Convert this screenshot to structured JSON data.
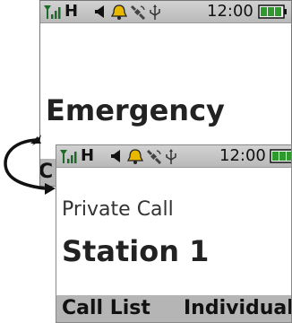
{
  "status_bar": {
    "network_letter": "H",
    "time": "12:00",
    "icons": [
      "signal-strength-icon",
      "speaker-icon",
      "bell-icon",
      "satellite-icon",
      "usb-icon",
      "battery-icon"
    ]
  },
  "back_screen": {
    "title": "Emergency",
    "softkey_left": "C"
  },
  "front_screen": {
    "call_type": "Private Call",
    "station": "Station 1",
    "softkey_left": "Call List",
    "softkey_right": "Individual"
  },
  "colors": {
    "battery_green": "#2e9a2e",
    "bell_yellow": "#e8b800",
    "status_bar_gray": "#c4c4c4",
    "softkey_bar_gray": "#b5b5b5"
  }
}
